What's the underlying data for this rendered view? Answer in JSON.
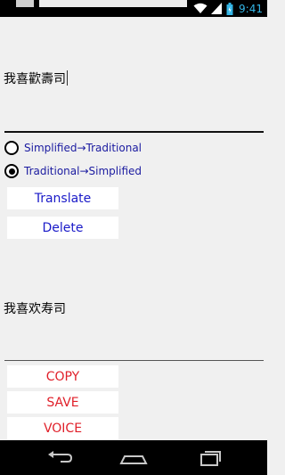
{
  "status_bar": {
    "time": "9:41"
  },
  "input": {
    "text": "我喜歡壽司"
  },
  "modes": {
    "option1": "Simplified→Traditional",
    "option2": "Traditional→Simplified",
    "selected": "option2"
  },
  "buttons": {
    "translate": "Translate",
    "delete": "Delete",
    "copy": "COPY",
    "save": "SAVE",
    "voice": "VOICE"
  },
  "output": {
    "text": "我喜欢寿司"
  },
  "colors": {
    "label_blue": "#1a1aa0",
    "button_blue": "#1a1ac8",
    "button_red": "#e0202a",
    "time_color": "#33b5e5"
  },
  "icons": {
    "status": [
      "wifi-icon",
      "signal-icon",
      "battery-icon"
    ],
    "nav": [
      "back-icon",
      "home-icon",
      "recent-apps-icon"
    ]
  }
}
